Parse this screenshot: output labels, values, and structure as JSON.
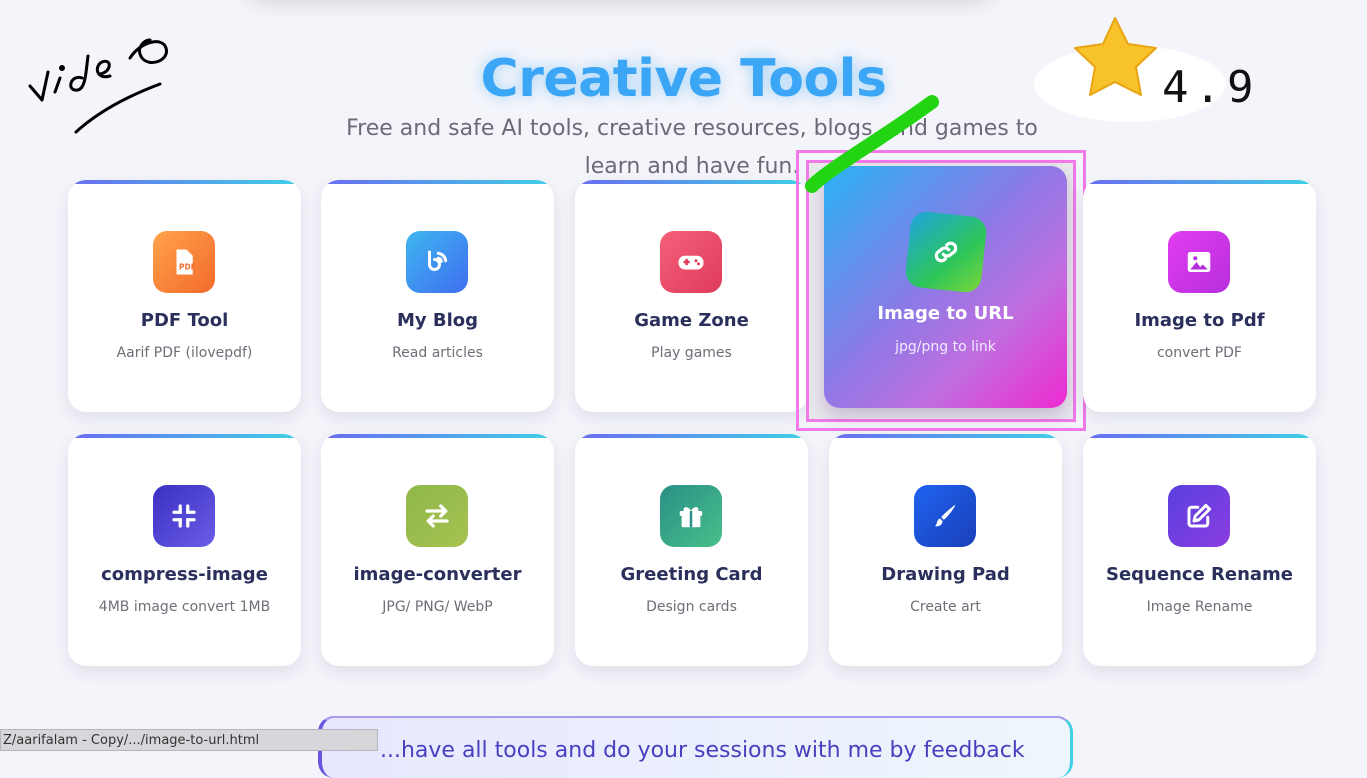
{
  "header": {
    "title": "Creative Tools",
    "subtitle": "Free and safe AI tools, creative resources, blogs, and games to learn and have fun."
  },
  "tools": [
    {
      "name": "PDF Tool",
      "desc": "Aarif PDF (ilovepdf)",
      "icon": "pdf-file-icon",
      "color": "#f9883a"
    },
    {
      "name": "My Blog",
      "desc": "Read articles",
      "icon": "blog-icon",
      "color": "#3f8ff0"
    },
    {
      "name": "Game Zone",
      "desc": "Play games",
      "icon": "gamepad-icon",
      "color": "#ea4c6c"
    },
    {
      "name": "Image to URL",
      "desc": "jpg/png to link",
      "icon": "link-icon",
      "color": "#2cc55a"
    },
    {
      "name": "Image to Pdf",
      "desc": "convert PDF",
      "icon": "image-icon",
      "color": "#d63be8"
    },
    {
      "name": "compress-image",
      "desc": "4MB image convert 1MB",
      "icon": "compress-icon",
      "color": "#4a3fd0"
    },
    {
      "name": "image-converter",
      "desc": "JPG/ PNG/ WebP",
      "icon": "swap-arrows-icon",
      "color": "#8fb84a"
    },
    {
      "name": "Greeting Card",
      "desc": "Design cards",
      "icon": "gift-icon",
      "color": "#2f9e8a"
    },
    {
      "name": "Drawing Pad",
      "desc": "Create art",
      "icon": "paintbrush-icon",
      "color": "#1f4fd8"
    },
    {
      "name": "Sequence Rename",
      "desc": "Image Rename",
      "icon": "edit-icon",
      "color": "#6a3fe0"
    }
  ],
  "annotations": {
    "handwritten_word": "video",
    "rating_value": "4.9",
    "star_icon": "star-icon"
  },
  "footer_banner": {
    "text": "...have all tools and do your sessions with me by feedback"
  },
  "status_bar": {
    "url": "Z/aarifalam - Copy/.../image-to-url.html"
  }
}
